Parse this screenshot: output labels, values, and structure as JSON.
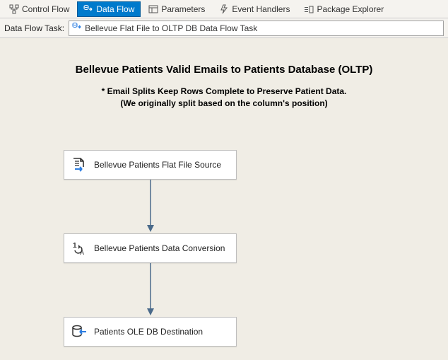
{
  "toolbar": {
    "tabs": [
      {
        "label": "Control Flow"
      },
      {
        "label": "Data Flow"
      },
      {
        "label": "Parameters"
      },
      {
        "label": "Event Handlers"
      },
      {
        "label": "Package Explorer"
      }
    ],
    "active_index": 1
  },
  "taskbar": {
    "label": "Data Flow Task:",
    "value": "Bellevue Flat File to OLTP DB Data Flow Task"
  },
  "canvas": {
    "title": "Bellevue Patients Valid Emails to Patients Database (OLTP)",
    "subtitle_line1": "* Email Splits Keep Rows Complete to Preserve Patient Data.",
    "subtitle_line2": "(We originally split based on the column's position)",
    "nodes": [
      {
        "label": "Bellevue Patients Flat File Source"
      },
      {
        "label": "Bellevue Patients Data Conversion"
      },
      {
        "label": "Patients OLE DB Destination"
      }
    ]
  }
}
